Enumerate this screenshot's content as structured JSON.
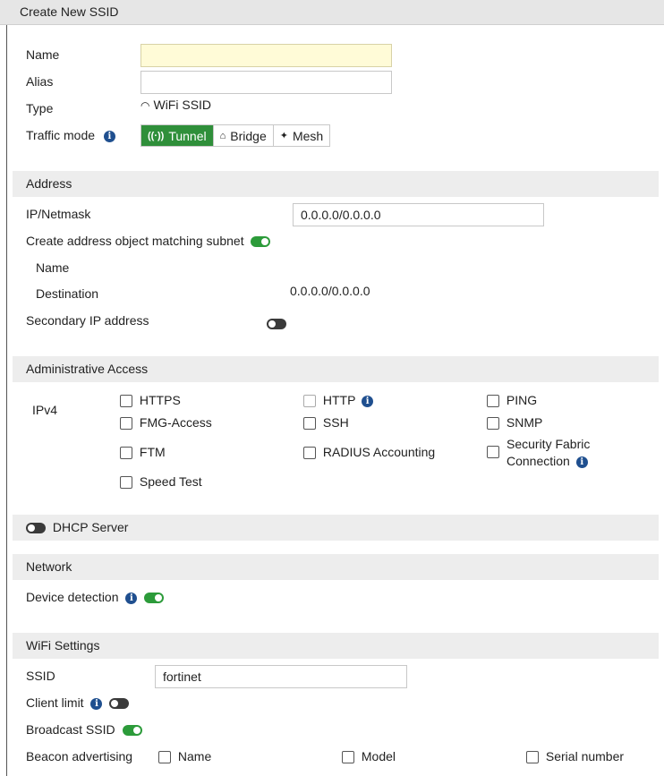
{
  "title": "Create New SSID",
  "general": {
    "name_label": "Name",
    "name_value": "",
    "alias_label": "Alias",
    "alias_value": "",
    "type_label": "Type",
    "type_value": "WiFi SSID",
    "type_icon": "wifi-icon",
    "traffic_mode_label": "Traffic mode",
    "traffic_modes": [
      {
        "label": "Tunnel",
        "icon": "broadcast-icon",
        "active": true
      },
      {
        "label": "Bridge",
        "icon": "access-point-icon",
        "active": false
      },
      {
        "label": "Mesh",
        "icon": "mesh-icon",
        "active": false
      }
    ]
  },
  "address": {
    "section_title": "Address",
    "ip_label": "IP/Netmask",
    "ip_value": "0.0.0.0/0.0.0.0",
    "create_object_label": "Create address object matching subnet",
    "create_object_on": true,
    "obj_name_label": "Name",
    "obj_dest_label": "Destination",
    "obj_dest_value": "0.0.0.0/0.0.0.0",
    "secondary_label": "Secondary IP address",
    "secondary_on": false
  },
  "admin_access": {
    "section_title": "Administrative Access",
    "ipv4_label": "IPv4",
    "options": {
      "https": "HTTPS",
      "http": "HTTP",
      "ping": "PING",
      "fmg": "FMG-Access",
      "ssh": "SSH",
      "snmp": "SNMP",
      "ftm": "FTM",
      "radius": "RADIUS Accounting",
      "fabric_line1": "Security Fabric",
      "fabric_line2": "Connection",
      "speedtest": "Speed Test"
    }
  },
  "dhcp": {
    "label": "DHCP Server",
    "on": false
  },
  "network": {
    "section_title": "Network",
    "device_detection_label": "Device detection",
    "device_detection_on": true
  },
  "wifi": {
    "section_title": "WiFi Settings",
    "ssid_label": "SSID",
    "ssid_value": "fortinet",
    "client_limit_label": "Client limit",
    "client_limit_on": false,
    "broadcast_label": "Broadcast SSID",
    "broadcast_on": true,
    "beacon_label": "Beacon advertising",
    "beacon_options": {
      "name": "Name",
      "model": "Model",
      "serial": "Serial number"
    }
  },
  "colors": {
    "accent_green": "#2f8f3a",
    "info_blue": "#1f4f8f",
    "section_bg": "#ededed",
    "input_highlight": "#fffbd7"
  }
}
